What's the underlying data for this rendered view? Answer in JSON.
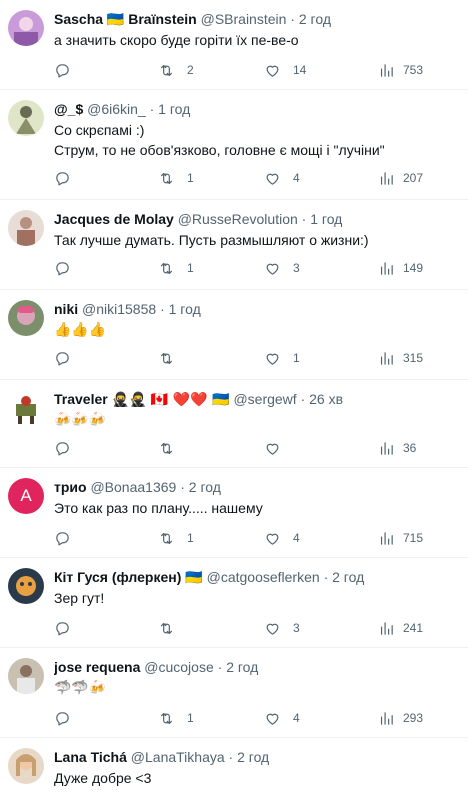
{
  "tweets": [
    {
      "name": "Sascha 🇺🇦 Braïnstein",
      "handle": "@SBrainstein",
      "sep": "·",
      "time": "2 год",
      "text": "а значить скоро буде горіти їх пе-ве-о",
      "replies": "",
      "retweets": "2",
      "likes": "14",
      "views": "753"
    },
    {
      "name": "@_$",
      "handle": "@6i6kin_",
      "sep": "·",
      "time": "1 год",
      "text": "Со скрєпамі :)\nСтрум, то не обов'язково,  головне є мощі і \"лучіни\"",
      "replies": "",
      "retweets": "1",
      "likes": "4",
      "views": "207"
    },
    {
      "name": "Jacques de Molay",
      "handle": "@RusseRevolution",
      "sep": "·",
      "time": "1 год",
      "text": "Так лучше думать. Пусть размышляют о жизни:)",
      "replies": "",
      "retweets": "1",
      "likes": "3",
      "views": "149"
    },
    {
      "name": "niki",
      "handle": "@niki15858",
      "sep": "·",
      "time": "1 год",
      "text": "👍👍👍",
      "replies": "",
      "retweets": "",
      "likes": "1",
      "views": "315"
    },
    {
      "name": "Traveler",
      "badges": "🥷🥷 🇨🇦 ❤️❤️ 🇺🇦",
      "handle": "@sergewf",
      "sep": "·",
      "time": "26 хв",
      "text": "🍻🍻🍻",
      "replies": "",
      "retweets": "",
      "likes": "",
      "views": "36"
    },
    {
      "name": "трио",
      "handle": "@Bonaa1369",
      "sep": "·",
      "time": "2 год",
      "text": "Это как раз по плану..... нашему",
      "replies": "",
      "retweets": "1",
      "likes": "4",
      "views": "715"
    },
    {
      "name": "Кіт Гуся (флеркен)",
      "badges": "🇺🇦",
      "handle": "@catgooseflerken",
      "sep": "·",
      "time": "2 год",
      "text": "Зер гут!",
      "replies": "",
      "retweets": "",
      "likes": "3",
      "views": "241"
    },
    {
      "name": "jose requena",
      "handle": "@cucojose",
      "sep": "·",
      "time": "2 год",
      "text": "🦈🦈🍻",
      "replies": "",
      "retweets": "1",
      "likes": "4",
      "views": "293"
    },
    {
      "name": "Lana Tichá",
      "handle": "@LanaTikhaya",
      "sep": "·",
      "time": "2 год",
      "text": "Дуже добре <3"
    }
  ],
  "avatar_letter": "A",
  "colors": {
    "border": "#eff3f4",
    "muted": "#536471",
    "text": "#0f1419",
    "avatar_trio": "#e0245e"
  },
  "icons": [
    "reply-icon",
    "retweet-icon",
    "heart-icon",
    "views-icon"
  ]
}
